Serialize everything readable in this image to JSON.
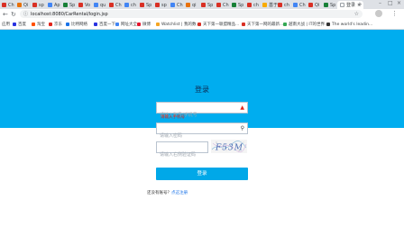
{
  "tabs": [
    {
      "label": "Ch",
      "color": "#d93025"
    },
    {
      "label": "Qi",
      "color": "#e8710a"
    },
    {
      "label": "sp",
      "color": "#d93025"
    },
    {
      "label": "Ap",
      "color": "#4285f4"
    },
    {
      "label": "Sp",
      "color": "#188038"
    },
    {
      "label": "Vo",
      "color": "#d93025"
    },
    {
      "label": "qu",
      "color": "#4285f4"
    },
    {
      "label": "Ch",
      "color": "#d93025"
    },
    {
      "label": "ch",
      "color": "#4285f4"
    },
    {
      "label": "Sp",
      "color": "#d93025"
    },
    {
      "label": "sp",
      "color": "#d93025"
    },
    {
      "label": "Ch",
      "color": "#4285f4"
    },
    {
      "label": "qi",
      "color": "#e8710a"
    },
    {
      "label": "Sp",
      "color": "#d93025"
    },
    {
      "label": "Ch",
      "color": "#d93025"
    },
    {
      "label": "Sp",
      "color": "#188038"
    },
    {
      "label": "ch",
      "color": "#d93025"
    },
    {
      "label": "基于",
      "color": "#f9ab00"
    },
    {
      "label": "ch",
      "color": "#d93025"
    },
    {
      "label": "Ch",
      "color": "#4285f4"
    },
    {
      "label": "Qi",
      "color": "#d93025"
    },
    {
      "label": "Sp",
      "color": "#188038"
    }
  ],
  "active_tab": {
    "label": "登录",
    "close": "×"
  },
  "new_tab": "+",
  "address": {
    "url": "localhost:8080/CarRental/login.jsp"
  },
  "bookmarks": [
    {
      "label": "应用",
      "color": "#4285f4"
    },
    {
      "label": "百度",
      "color": "#2932e1"
    },
    {
      "label": "淘宝",
      "color": "#ff5000"
    },
    {
      "label": "京东",
      "color": "#e1251b"
    },
    {
      "label": "比特网络",
      "color": "#1a73e8"
    },
    {
      "label": "百度一下",
      "color": "#2932e1"
    },
    {
      "label": "网址大全",
      "color": "#4285f4"
    },
    {
      "label": "微博",
      "color": "#e6162d"
    },
    {
      "label": "Watchlist | 我的数...",
      "color": "#f5a623"
    },
    {
      "label": "天下第一联盟精品...",
      "color": "#d93025"
    },
    {
      "label": "天下第一网的最新...",
      "color": "#d93025"
    },
    {
      "label": "越南大战 | IT的世界...",
      "color": "#34a853"
    },
    {
      "label": "The world's leadin...",
      "color": "#333333"
    }
  ],
  "login": {
    "title": "登录",
    "username_placeholder": "请输入账号/手机号",
    "username_error": "请输入手机号",
    "password_placeholder": "请输入密码",
    "captcha_placeholder": "请输入右侧验证码",
    "captcha_text": "F53M",
    "submit_label": "登录",
    "footer_text": "还没有账号？",
    "footer_link": "点这注册"
  },
  "colors": {
    "hero": "#00adef",
    "button": "#00a8e8",
    "error": "#e0261a"
  }
}
